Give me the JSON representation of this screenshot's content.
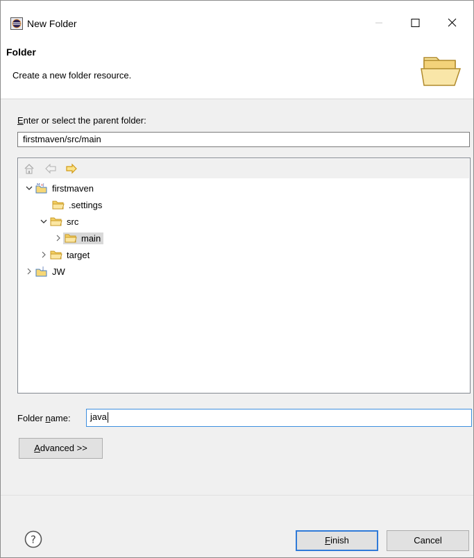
{
  "window": {
    "title": "New Folder",
    "controls": {
      "minimize": "minimize",
      "maximize": "maximize",
      "close": "close"
    }
  },
  "banner": {
    "title": "Folder",
    "description": "Create a new folder resource.",
    "icon": "open-folder-icon"
  },
  "parent": {
    "label_prefix": "",
    "label_mnemonic": "E",
    "label_rest": "nter or select the parent folder:",
    "value": "firstmaven/src/main"
  },
  "tree": {
    "toolbar": [
      "home-icon",
      "back-icon",
      "forward-icon"
    ],
    "nodes": [
      {
        "label": "firstmaven",
        "type": "maven-project",
        "expanded": true
      },
      {
        "label": ".settings",
        "type": "folder"
      },
      {
        "label": "src",
        "type": "folder",
        "expanded": true
      },
      {
        "label": "main",
        "type": "folder",
        "expanded": false,
        "selected": true
      },
      {
        "label": "target",
        "type": "folder",
        "expanded": false
      },
      {
        "label": "JW",
        "type": "java-project",
        "expanded": false
      }
    ]
  },
  "folder_name": {
    "label_prefix": "Folder ",
    "label_mnemonic": "n",
    "label_rest": "ame:",
    "value": "java"
  },
  "advanced": {
    "label_mnemonic": "A",
    "label_rest": "dvanced >>"
  },
  "footer": {
    "help_icon": "help-icon",
    "finish_mnemonic": "F",
    "finish_rest": "inish",
    "cancel_label": "Cancel"
  },
  "colors": {
    "accent": "#2f7ad8",
    "folder": "#f4c542",
    "selection": "#d9d9d9"
  }
}
